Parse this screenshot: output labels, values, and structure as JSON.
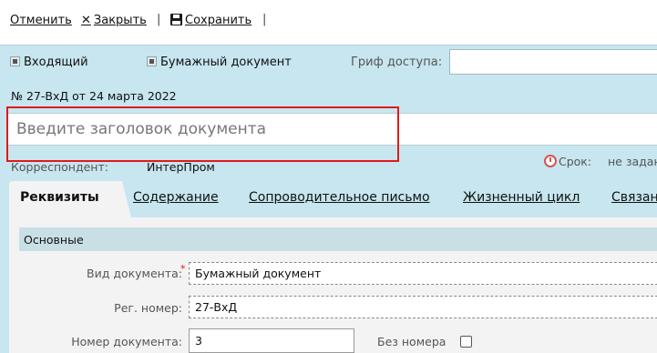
{
  "toolbar": {
    "cancel_label": "Отменить",
    "close_label": "Закрыть",
    "save_label": "Сохранить",
    "separator": "|"
  },
  "doc_type": {
    "incoming_label": "Входящий",
    "paper_label": "Бумажный документ"
  },
  "access": {
    "label": "Гриф доступа:",
    "value": ""
  },
  "doc_number_line": "№  27-ВхД  от  24 марта 2022",
  "title_field": {
    "placeholder": "Введите заголовок документа"
  },
  "correspondent": {
    "label": "Корреспондент:",
    "value": "ИнтерПром"
  },
  "deadline": {
    "label": "Срок:",
    "value": "не задан"
  },
  "tabs": [
    {
      "label": "Реквизиты",
      "active": true
    },
    {
      "label": "Содержание",
      "active": false
    },
    {
      "label": "Сопроводительное письмо",
      "active": false
    },
    {
      "label": "Жизненный цикл",
      "active": false
    },
    {
      "label": "Связанные",
      "active": false
    }
  ],
  "section": {
    "title": "Основные"
  },
  "fields": {
    "doc_kind": {
      "label": "Вид документа:",
      "value": "Бумажный документ",
      "required": true
    },
    "reg_number": {
      "label": "Рег. номер:",
      "value": "27-ВхД"
    },
    "doc_number": {
      "label": "Номер документа:",
      "value": "3"
    },
    "no_number": {
      "label": "Без номера",
      "checked": false
    }
  },
  "colors": {
    "background": "#c7e6ef",
    "highlight_border": "#e11a1a",
    "content_panel": "#f3f3f3",
    "section_header": "#c8dfe6"
  }
}
